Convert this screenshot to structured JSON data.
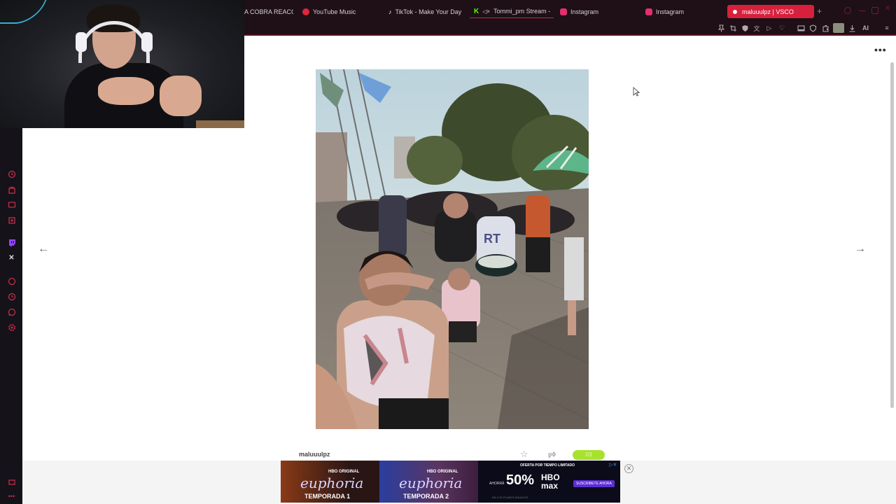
{
  "browser": {
    "tabs": [
      {
        "label": "A COBRA REACC",
        "icon": "generic",
        "color": "#d6cfd3"
      },
      {
        "label": "YouTube Music",
        "icon": "youtube-music",
        "color": "#e0263b"
      },
      {
        "label": "TikTok - Make Your Day",
        "icon": "tiktok",
        "color": "#ffffff"
      },
      {
        "label": "Tommi_pm Stream -",
        "icon": "kick",
        "color": "#53fc18"
      },
      {
        "label": "Instagram",
        "icon": "instagram",
        "color": "#e1306c"
      },
      {
        "label": "Instagram",
        "icon": "instagram",
        "color": "#e1306c"
      },
      {
        "label": "maluuulpz | VSCO",
        "icon": "vsco",
        "color": "#ffffff"
      }
    ],
    "toolbar_ai_label": "AI"
  },
  "post": {
    "username": "maluuulpz",
    "badge_label": "03"
  },
  "ad": {
    "panel1_title": "euphoria",
    "panel1_season": "TEMPORADA 1",
    "panel2_title": "euphoria",
    "panel2_season": "TEMPORADA 2",
    "hbo_small": "HBO ORIGINAL",
    "offer_top": "OFERTA POR TIEMPO LIMITADO",
    "offer_now": "AHORRÁ",
    "offer_pct": "50%",
    "offer_logo_1": "HBO",
    "offer_logo_2": "max",
    "offer_cta": "SUSCRIBETE AHORA",
    "offer_fine": "EN LOS PLANES ANUALES"
  },
  "colors": {
    "accent": "#d8203c",
    "badge": "#a6e22e",
    "browser_bg": "#1e1016"
  }
}
